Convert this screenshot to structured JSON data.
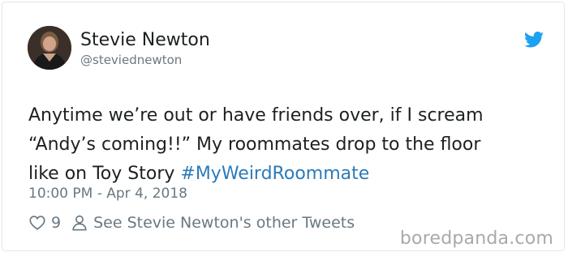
{
  "tweet": {
    "author": {
      "display_name": "Stevie Newton",
      "handle": "@steviednewton",
      "avatar": "avatar-photo"
    },
    "text_lines": [
      "Anytime we’re out or have friends over, if I scream",
      "“Andy’s coming!!” My roommates drop to the floor",
      "like on Toy Story "
    ],
    "hashtag": "#MyWeirdRoommate",
    "timestamp": "10:00 PM - Apr 4, 2018",
    "likes": "9",
    "other_tweets_link": "See Stevie Newton's other Tweets",
    "icons": {
      "brand": "twitter-bird-icon",
      "like": "heart-icon",
      "profile": "person-icon"
    },
    "colors": {
      "brand_blue": "#1da1f2",
      "hashtag_blue": "#2b7bb9",
      "secondary_text": "#697882"
    }
  },
  "watermark": "boredpanda.com"
}
